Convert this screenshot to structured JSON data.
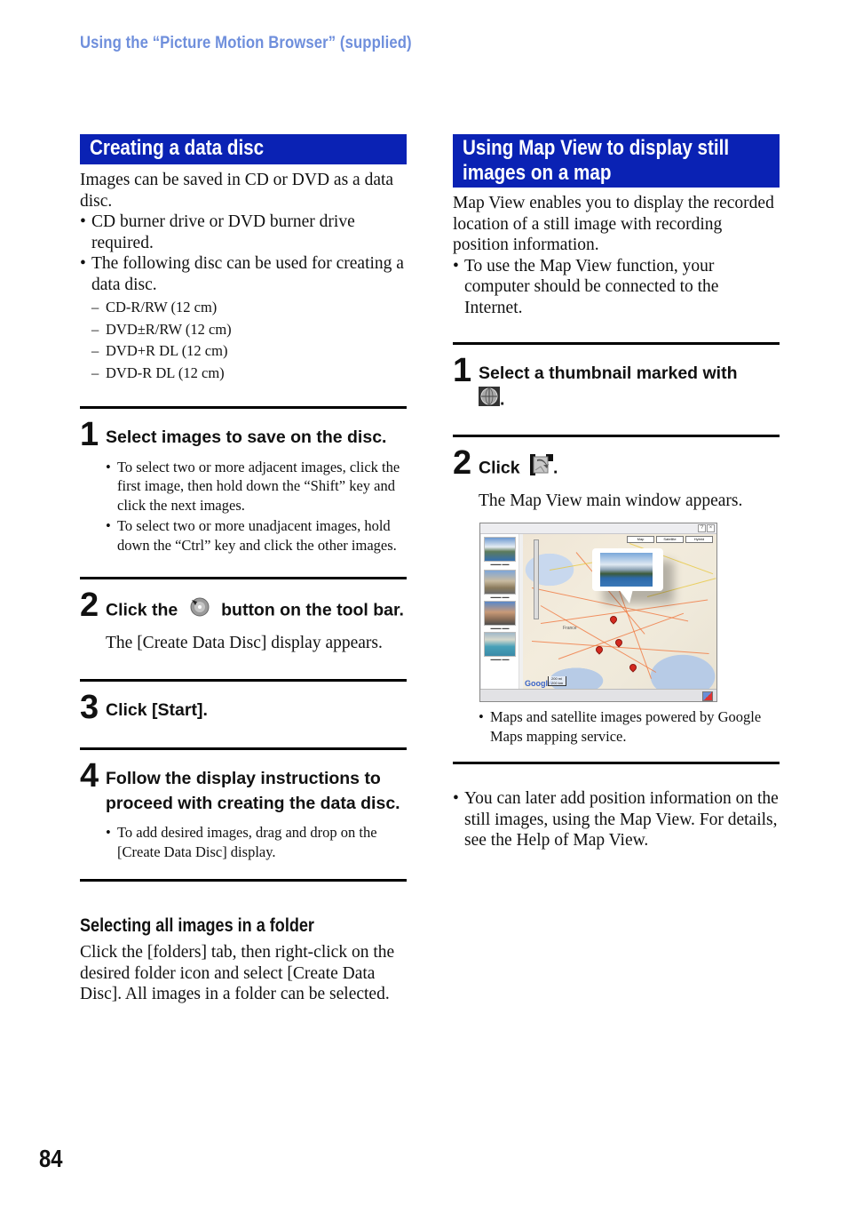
{
  "running_head": "Using the “Picture Motion Browser” (supplied)",
  "page_number": "84",
  "colors": {
    "section_bar": "#0a22b4",
    "running_head": "#6f8fdc"
  },
  "left": {
    "section_title": "Creating a data disc",
    "intro": "Images can be saved in CD or DVD as a data disc.",
    "bullets": [
      "CD burner drive or DVD burner drive required.",
      "The following disc can be used for creating a data disc."
    ],
    "disc_types": [
      "CD-R/RW (12 cm)",
      "DVD±R/RW (12 cm)",
      "DVD+R DL (12 cm)",
      "DVD-R DL (12 cm)"
    ],
    "steps": [
      {
        "num": "1",
        "title": "Select images to save on the disc.",
        "notes": [
          "To select two or more adjacent images, click the first image, then hold down the “Shift” key and click the next images.",
          "To select two or more unadjacent images, hold down the “Ctrl” key and click the other images."
        ]
      },
      {
        "num": "2",
        "title_before": "Click the",
        "icon": "create-data-disc-icon",
        "title_after": "button on the tool bar.",
        "text": "The [Create Data Disc] display appears."
      },
      {
        "num": "3",
        "title": "Click [Start]."
      },
      {
        "num": "4",
        "title": "Follow the display instructions to proceed with creating the data disc.",
        "notes": [
          "To add desired images, drag and drop on the [Create Data Disc] display."
        ]
      }
    ],
    "subsection_title": "Selecting all images in a folder",
    "subsection_text": "Click the [folders] tab, then right-click on the desired folder icon and select [Create Data Disc]. All images in a folder can be selected."
  },
  "right": {
    "section_title_line1": "Using Map View to display still",
    "section_title_line2": "images on a map",
    "intro": "Map View enables you to display the recorded location of a still image with recording position information.",
    "bullets": [
      "To use the Map View function, your computer should be connected to the Internet."
    ],
    "steps": [
      {
        "num": "1",
        "title": "Select a thumbnail marked with",
        "icon": "gps-globe-icon",
        "title_end": "."
      },
      {
        "num": "2",
        "title": "Click",
        "icon": "map-view-icon",
        "title_end": ".",
        "text": "The Map View main window appears."
      }
    ],
    "map_window": {
      "map_type_buttons": [
        "Map",
        "Satellite",
        "Hybrid"
      ],
      "map_label_country": "France",
      "logo": "Google",
      "scale_labels": [
        "200 mi",
        "200 km"
      ],
      "help_button": "?",
      "close_button": "×"
    },
    "map_note": "Maps and satellite images powered by Google Maps mapping service.",
    "final_bullet": "You can later add position information on the still images, using the Map View. For details, see the Help of Map View."
  }
}
